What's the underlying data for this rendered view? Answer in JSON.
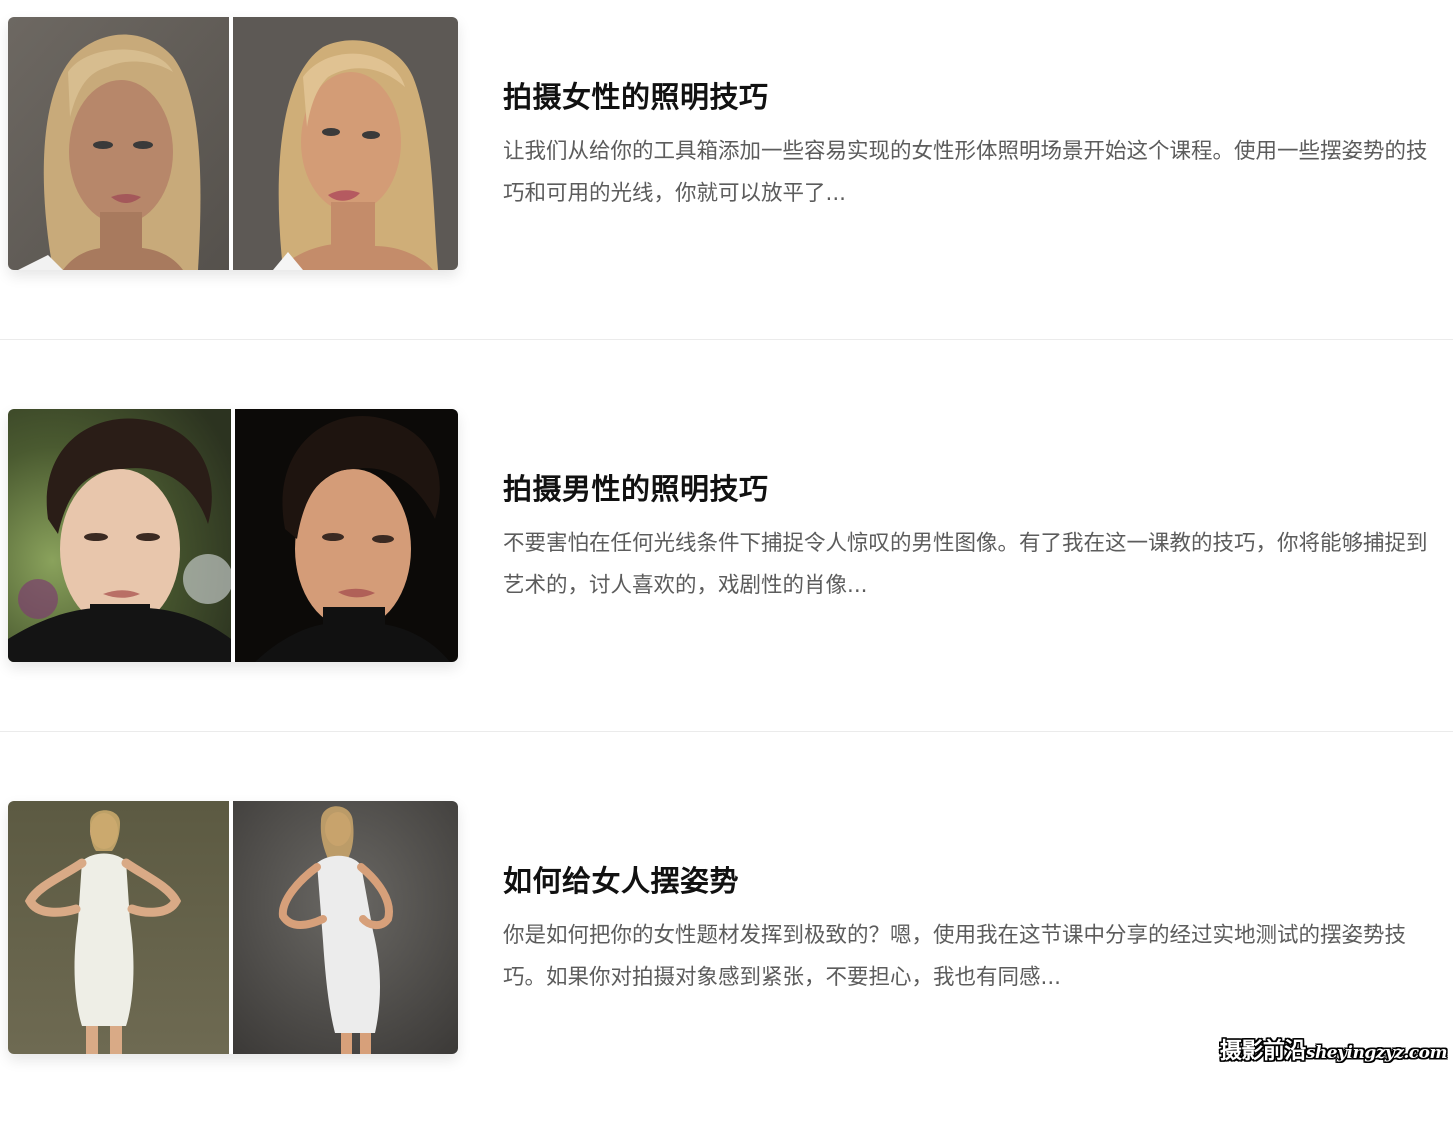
{
  "courses": [
    {
      "title": "拍摄女性的照明技巧",
      "description": "让我们从给你的工具箱添加一些容易实现的女性形体照明场景开始这个课程。使用一些摆姿势的技巧和可用的光线，你就可以放平了...",
      "images": [
        "woman-portrait-flat-light",
        "woman-portrait-shaped-light"
      ]
    },
    {
      "title": "拍摄男性的照明技巧",
      "description": "不要害怕在任何光线条件下捕捉令人惊叹的男性图像。有了我在这一课教的技巧，你将能够捕捉到艺术的，讨人喜欢的，戏剧性的肖像...",
      "images": [
        "man-portrait-outdoor",
        "man-portrait-studio-dark"
      ]
    },
    {
      "title": "如何给女人摆姿势",
      "description": "你是如何把你的女性题材发挥到极致的？嗯，使用我在这节课中分享的经过实地测试的摆姿势技巧。如果你对拍摄对象感到紧张，不要担心，我也有同感...",
      "images": [
        "woman-full-body-pose-front",
        "woman-full-body-pose-angled"
      ]
    }
  ],
  "watermark": {
    "brand": "摄影前沿",
    "url": "sheyingzyz.com"
  },
  "colors": {
    "title": "#111111",
    "description": "#5c5c5c",
    "divider": "#ebebeb"
  }
}
